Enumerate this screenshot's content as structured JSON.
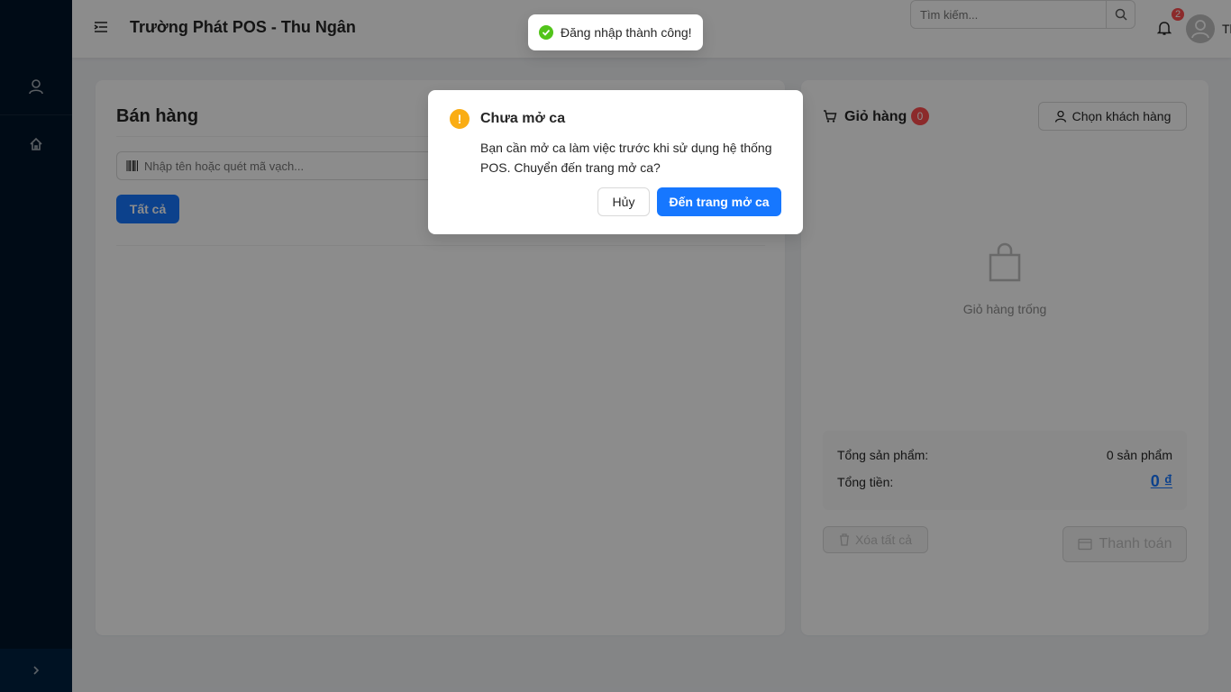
{
  "header": {
    "title": "Trường Phát POS - Thu Ngân",
    "search_placeholder": "Tìm kiếm...",
    "notification_count": "2",
    "user_name": "Th"
  },
  "sidebar": {
    "items": [
      {
        "icon": "user-icon"
      },
      {
        "icon": "home-icon"
      }
    ],
    "trigger_icon": "chevron-right-icon"
  },
  "sales": {
    "title": "Bán hàng",
    "search_placeholder": "Nhập tên hoặc quét mã vạch...",
    "filter_all": "Tất cả"
  },
  "cart": {
    "title": "Giỏ hàng",
    "count": "0",
    "choose_customer": "Chọn khách hàng",
    "empty_text": "Giỏ hàng trống",
    "total_items_label": "Tổng sản phẩm:",
    "total_items_value": "0 sản phẩm",
    "total_amount_label": "Tổng tiền:",
    "total_amount_value": "0 ₫",
    "clear_all": "Xóa tất cả",
    "checkout": "Thanh toán"
  },
  "toast": {
    "message": "Đăng nhập thành công!"
  },
  "modal": {
    "title": "Chưa mở ca",
    "content": "Bạn cần mở ca làm việc trước khi sử dụng hệ thống POS. Chuyển đến trang mở ca?",
    "cancel": "Hủy",
    "ok": "Đến trang mở ca"
  },
  "colors": {
    "primary": "#1677ff",
    "sidebar": "#001529",
    "warning": "#faad14",
    "success": "#52c41a",
    "danger": "#ff4d4f"
  }
}
